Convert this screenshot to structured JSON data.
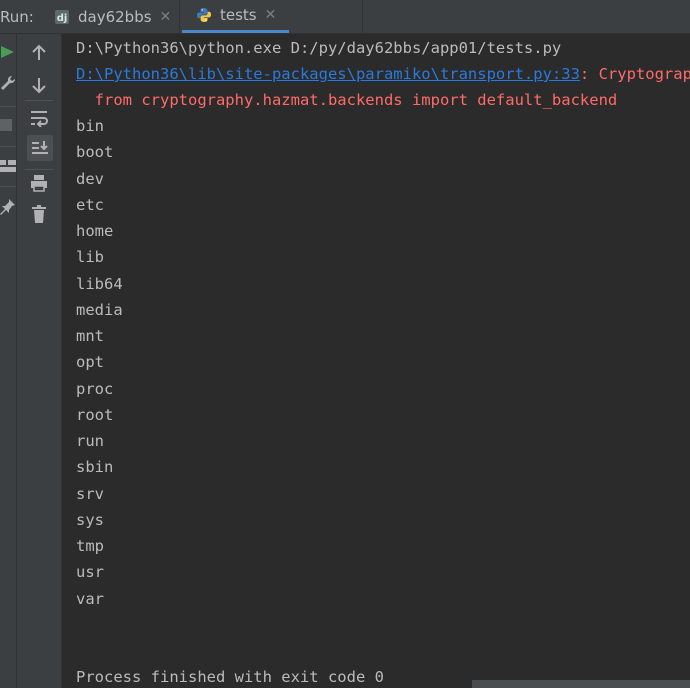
{
  "run_label": "Run:",
  "tabs": [
    {
      "label": "day62bbs",
      "close": "✕"
    },
    {
      "label": "tests",
      "close": "✕"
    }
  ],
  "console": {
    "command": "D:\\Python36\\python.exe D:/py/day62bbs/app01/tests.py",
    "warning_link": "D:\\Python36\\lib\\site-packages\\paramiko\\transport.py:33",
    "warning_rest": ": CryptographyDeprecationWarning",
    "warning_line2": "  from cryptography.hazmat.backends import default_backend",
    "output": [
      "bin",
      "boot",
      "dev",
      "etc",
      "home",
      "lib",
      "lib64",
      "media",
      "mnt",
      "opt",
      "proc",
      "root",
      "run",
      "sbin",
      "srv",
      "sys",
      "tmp",
      "usr",
      "var"
    ],
    "exit_message": "Process finished with exit code 0"
  },
  "colors": {
    "background": "#2b2b2b",
    "panel": "#3c3f41",
    "warning": "#ff6b68",
    "link": "#287bde",
    "tab_underline": "#4a88c7",
    "run_green": "#499c54"
  },
  "icons": {
    "rerun": "play-icon",
    "settings": "wrench-icon",
    "stop": "stop-icon",
    "layout": "layout-icon",
    "pin": "pin-icon",
    "up": "arrow-up-icon",
    "down": "arrow-down-icon",
    "wrap": "soft-wrap-icon",
    "scroll_end": "scroll-to-end-icon",
    "print": "print-icon",
    "clear": "trash-icon"
  }
}
